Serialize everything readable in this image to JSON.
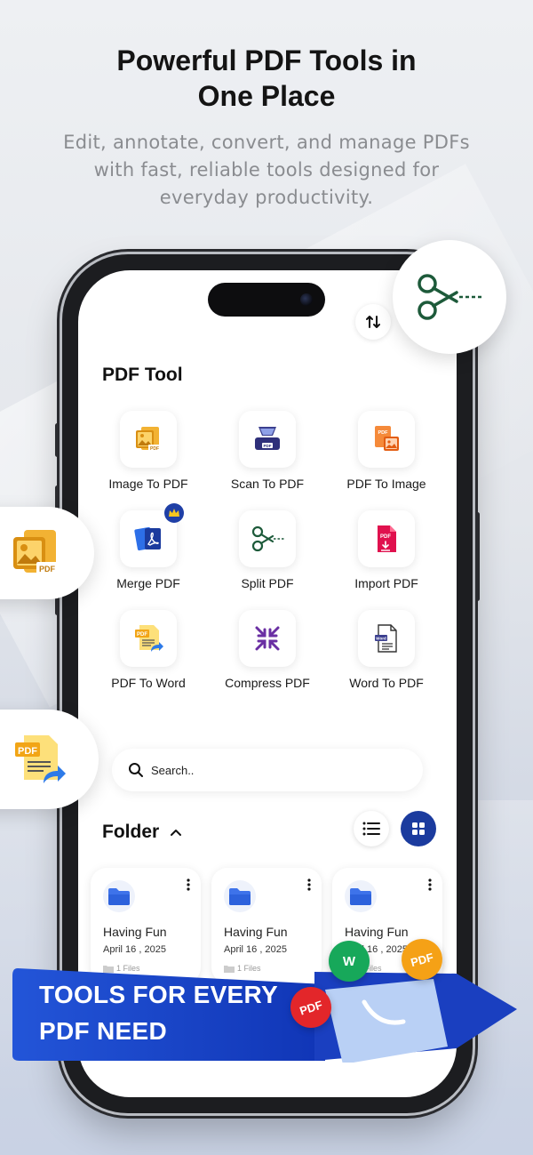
{
  "headline": {
    "line1": "Powerful PDF Tools in",
    "line2": "One Place"
  },
  "subhead": {
    "line1": "Edit, annotate, convert, and manage PDFs",
    "line2": "with fast, reliable tools designed for",
    "line3": "everyday productivity."
  },
  "app": {
    "section_title": "PDF Tool",
    "tools": [
      {
        "label": "Image To PDF",
        "icon": "image-to-pdf-icon"
      },
      {
        "label": "Scan To PDF",
        "icon": "scanner-icon"
      },
      {
        "label": "PDF To Image",
        "icon": "pdf-to-image-icon"
      },
      {
        "label": "Merge PDF",
        "icon": "merge-pdf-icon",
        "premium": true
      },
      {
        "label": "Split PDF",
        "icon": "scissors-icon"
      },
      {
        "label": "Import PDF",
        "icon": "import-pdf-icon"
      },
      {
        "label": "PDF To Word",
        "icon": "pdf-to-word-icon"
      },
      {
        "label": "Compress PDF",
        "icon": "compress-icon"
      },
      {
        "label": "Word  To PDF",
        "icon": "word-to-pdf-icon"
      }
    ],
    "search": {
      "placeholder": "Search.."
    },
    "folder_section": {
      "title": "Folder"
    },
    "folders": [
      {
        "name": "Having Fun",
        "date": "April 16 , 2025",
        "count": "1 Files"
      },
      {
        "name": "Having Fun",
        "date": "April 16 , 2025",
        "count": "1 Files"
      },
      {
        "name": "Having Fun",
        "date": "April 16 , 2025",
        "count": "1 Files"
      }
    ]
  },
  "banner": {
    "line1": "TOOLS FOR EVERY",
    "line2": "PDF NEED",
    "badges": {
      "word": "W",
      "pdf_orange": "PDF",
      "pdf_red": "PDF"
    }
  },
  "colors": {
    "accent_blue": "#1b3b9e",
    "banner_blue": "#1746c9",
    "folder_blue": "#3e73ea",
    "scissors_green": "#1d5a3a",
    "compress_purple": "#6a2fa3"
  }
}
